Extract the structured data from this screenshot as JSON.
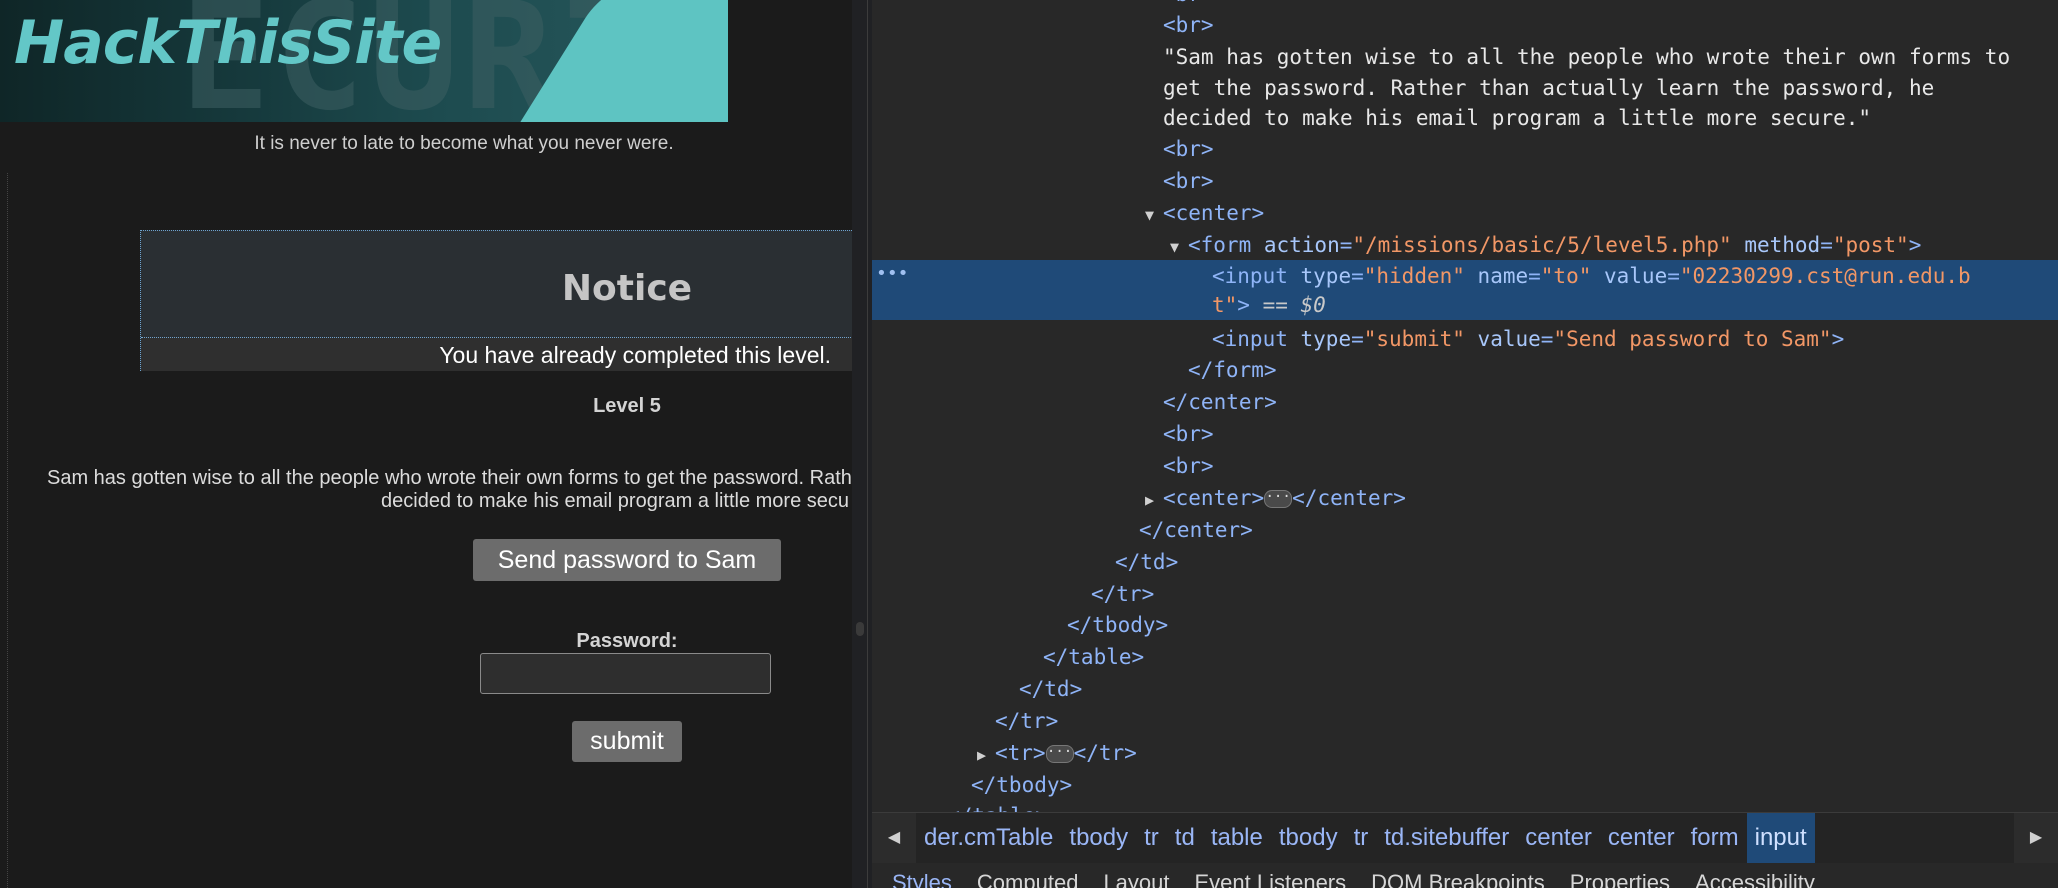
{
  "site": {
    "logo": "HackThisSite",
    "tagline": "It is never to late to become what you never were.",
    "notice_title": "Notice",
    "notice_message": "You have already completed this level.",
    "level_title": "Level 5",
    "description_line1": "Sam has gotten wise to all the people who wrote their own forms to get the password. Rath",
    "description_line2": "decided to make his email program a little more secu",
    "send_button": "Send password to Sam",
    "password_label": "Password:",
    "submit_button": "submit"
  },
  "devtools": {
    "text_node": [
      "\"Sam has gotten wise to all the people who wrote their own forms to",
      "get the password. Rather than actually learn the password, he",
      "decided to make his email program a little more secure.\""
    ],
    "form_action": "\"/missions/basic/5/level5.php\"",
    "form_method": "\"post\"",
    "hidden_type": "\"hidden\"",
    "hidden_name": "\"to\"",
    "hidden_value_1": "\"02230299.cst@run.edu.b",
    "hidden_value_2": "t\"",
    "dollar_zero": "== $0",
    "submit_type": "\"submit\"",
    "submit_value": "\"Send password to Sam\"",
    "breadcrumbs": [
      "der.cmTable",
      "tbody",
      "tr",
      "td",
      "table",
      "tbody",
      "tr",
      "td.sitebuffer",
      "center",
      "center",
      "form",
      "input"
    ],
    "tabs": [
      "Styles",
      "Computed",
      "Layout",
      "Event Listeners",
      "DOM Breakpoints",
      "Properties",
      "Accessibility"
    ]
  }
}
